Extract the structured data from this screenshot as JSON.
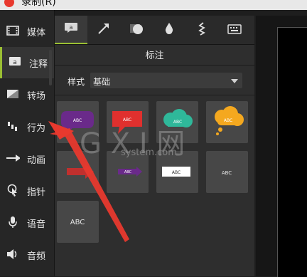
{
  "window": {
    "title": "录制(R)"
  },
  "sidebar": {
    "items": [
      {
        "label": "媒体",
        "icon": "film-icon"
      },
      {
        "label": "注释",
        "icon": "annotation-icon"
      },
      {
        "label": "转场",
        "icon": "transition-icon"
      },
      {
        "label": "行为",
        "icon": "behavior-icon"
      },
      {
        "label": "动画",
        "icon": "animation-icon"
      },
      {
        "label": "指针",
        "icon": "cursor-icon"
      },
      {
        "label": "语音",
        "icon": "microphone-icon"
      },
      {
        "label": "音频",
        "icon": "speaker-icon"
      }
    ]
  },
  "tabs": [
    {
      "icon": "callout-tab-icon"
    },
    {
      "icon": "arrow-tab-icon"
    },
    {
      "icon": "shape-tab-icon"
    },
    {
      "icon": "blur-tab-icon"
    },
    {
      "icon": "sketch-tab-icon"
    },
    {
      "icon": "keystroke-tab-icon"
    }
  ],
  "panel": {
    "title": "标注",
    "style_label": "样式",
    "style_value": "基础"
  },
  "tiles": [
    {
      "text": "ABC",
      "shape": "speech-bubble",
      "color": "#6a2a8a"
    },
    {
      "text": "ABC",
      "shape": "speech-bubble",
      "color": "#e0302e"
    },
    {
      "text": "ABC",
      "shape": "cloud",
      "color": "#2fb89a"
    },
    {
      "text": "ABC",
      "shape": "thought-cloud",
      "color": "#f4a81f"
    },
    {
      "text": "ABC",
      "shape": "arrow",
      "color": "#c0302e"
    },
    {
      "text": "ABC",
      "shape": "arrow",
      "color": "#6a2a8a"
    },
    {
      "text": "ABC",
      "shape": "rectangle",
      "color": "#ffffff"
    },
    {
      "text": "ABC",
      "shape": "text",
      "color": "#474747"
    },
    {
      "text": "ABC",
      "shape": "text",
      "color": "#474747"
    }
  ],
  "watermark": {
    "text": "G X I 网",
    "subtext": "system.com"
  },
  "colors": {
    "accent": "#9bbf33",
    "record": "#e8392e",
    "annotation_arrow": "#e8392e"
  }
}
